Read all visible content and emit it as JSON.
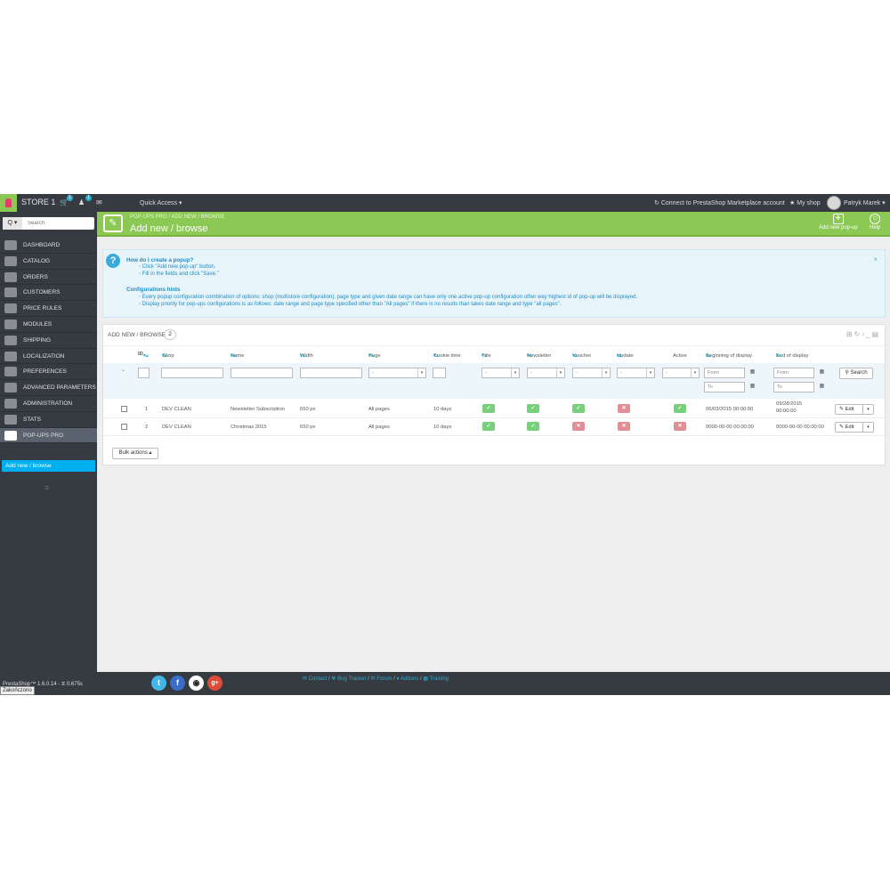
{
  "topbar": {
    "store_name": "STORE 1",
    "orders_badge": "1",
    "customers_badge": "1",
    "quick_access": "Quick Access ▾",
    "connect": "Connect to PrestaShop Marketplace account",
    "my_shop": "My shop",
    "user": "Patryk Marek ▾"
  },
  "sidebar": {
    "search_button": "Q ▾",
    "search_placeholder": "Search",
    "items": [
      {
        "label": "DASHBOARD"
      },
      {
        "label": "CATALOG"
      },
      {
        "label": "ORDERS"
      },
      {
        "label": "CUSTOMERS"
      },
      {
        "label": "PRICE RULES"
      },
      {
        "label": "MODULES"
      },
      {
        "label": "SHIPPING"
      },
      {
        "label": "LOCALIZATION"
      },
      {
        "label": "PREFERENCES"
      },
      {
        "label": "ADVANCED PARAMETERS"
      },
      {
        "label": "ADMINISTRATION"
      },
      {
        "label": "STATS"
      },
      {
        "label": "POP-UPS PRO"
      }
    ],
    "submenu_active": "Add new / browse"
  },
  "page_head": {
    "breadcrumb": "POP-UPS PRO  /  ADD NEW / BROWSE",
    "title": "Add new / browse",
    "add_button": "Add new pop-up",
    "help_button": "Help"
  },
  "info": {
    "heading1": "How do I create a popup?",
    "step1": "◦ Click \"Add new pop-up\" button.",
    "step2": "◦ Fill in the fields and click \"Save.\"",
    "heading2": "Configurations hints",
    "hint1": "◦ Every popup configuration combination of options: shop (multistore configuration), page type and given date range can have only one active pop-up configuration other way highest id of pop-up will be displayed.",
    "hint2": "◦ Display priority for pop-ups configurations is as follows: date range and page type specified other than \"All pages\" if there is no results than takes date range and type \"all pages\"."
  },
  "list": {
    "title": "ADD NEW / BROWSE",
    "count": "2",
    "columns": {
      "id": "ID",
      "shop": "Shop",
      "name": "Name",
      "width": "Width",
      "page": "Page",
      "cookie": "Cookie time",
      "title": "Title",
      "newsletter": "Newsletter",
      "voucher": "Voucher",
      "update": "Update",
      "active": "Active",
      "begin": "Beginning of display",
      "end": "End of display"
    },
    "filters": {
      "select_default": "-",
      "from_placeholder": "From",
      "to_placeholder": "To",
      "search_button": "Search"
    },
    "rows": [
      {
        "id": "1",
        "shop": "DEV CLEAN",
        "name": "Newsletter Subscription",
        "width": "650 px",
        "page": "All pages",
        "cookie": "10 days",
        "title": true,
        "newsletter": true,
        "voucher": true,
        "update": false,
        "active": true,
        "begin": "06/03/2015 00:00:00",
        "end_line1": "09/28/2015",
        "end_line2": "00:00:00"
      },
      {
        "id": "2",
        "shop": "DEV CLEAN",
        "name": "Christmas 2015",
        "width": "650 px",
        "page": "All pages",
        "cookie": "10 days",
        "title": true,
        "newsletter": true,
        "voucher": false,
        "update": false,
        "active": false,
        "begin": "0000-00-00 00:00:00",
        "end_line1": "0000-00-00 00:00:00",
        "end_line2": ""
      }
    ],
    "edit_label": "Edit",
    "bulk_actions": "Bulk actions ▴"
  },
  "footer": {
    "version": "PrestaShop™ 1.6.0.14 - ⧖ 0.675s",
    "status_tooltip": "Zakończono",
    "contact": "Contact",
    "bug_tracker": "Bug Tracker",
    "forum": "Forum",
    "addons": "Addons",
    "training": "Training"
  },
  "colors": {
    "accent_green": "#8bc954",
    "sidebar_bg": "#363a41",
    "link_blue": "#2eacce",
    "status_on": "#78d07d",
    "status_off": "#e08f95"
  }
}
